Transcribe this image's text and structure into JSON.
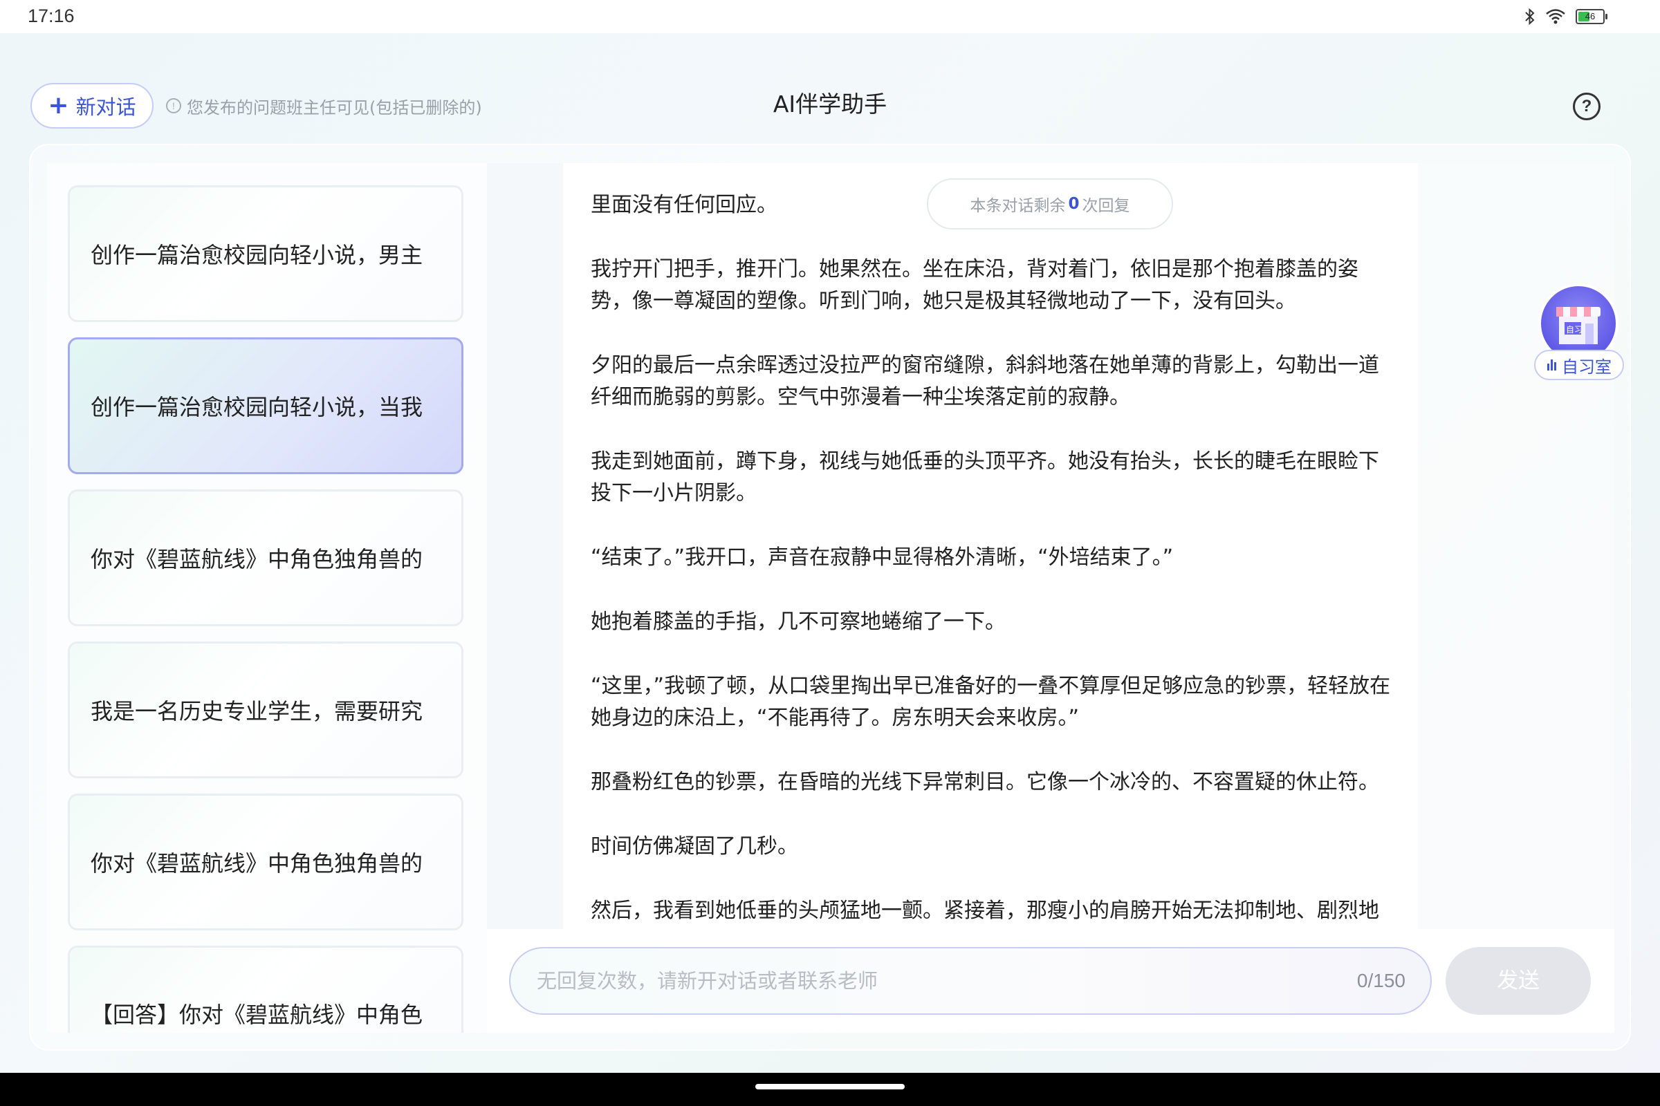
{
  "status_bar": {
    "time": "17:16",
    "battery_level": "46",
    "icons": [
      "bluetooth-icon",
      "wifi-icon",
      "battery-icon"
    ]
  },
  "header": {
    "new_chat_label": "新对话",
    "notice": "您发布的问题班主任可见(包括已删除的)",
    "title": "AI伴学助手",
    "help_symbol": "?"
  },
  "sidebar": {
    "items": [
      {
        "label": "创作一篇治愈校园向轻小说，男主",
        "active": false
      },
      {
        "label": "创作一篇治愈校园向轻小说，当我",
        "active": true
      },
      {
        "label": "你对《碧蓝航线》中角色独角兽的",
        "active": false
      },
      {
        "label": "我是一名历史专业学生，需要研究",
        "active": false
      },
      {
        "label": "你对《碧蓝航线》中角色独角兽的",
        "active": false
      },
      {
        "label": "【回答】你对《碧蓝航线》中角色",
        "active": false
      }
    ]
  },
  "chat": {
    "remaining_prefix": "本条对话剩余",
    "remaining_count": "0",
    "remaining_suffix": "次回复",
    "paragraphs": [
      "里面没有任何回应。",
      "我拧开门把手，推开门。她果然在。坐在床沿，背对着门，依旧是那个抱着膝盖的姿势，像一尊凝固的塑像。听到门响，她只是极其轻微地动了一下，没有回头。",
      "夕阳的最后一点余晖透过没拉严的窗帘缝隙，斜斜地落在她单薄的背影上，勾勒出一道纤细而脆弱的剪影。空气中弥漫着一种尘埃落定前的寂静。",
      "我走到她面前，蹲下身，视线与她低垂的头顶平齐。她没有抬头，长长的睫毛在眼睑下投下一小片阴影。",
      "“结束了。”我开口，声音在寂静中显得格外清晰，“外培结束了。”",
      "她抱着膝盖的手指，几不可察地蜷缩了一下。",
      "“这里，”我顿了顿，从口袋里掏出早已准备好的一叠不算厚但足够应急的钞票，轻轻放在她身边的床沿上，“不能再待了。房东明天会来收房。”",
      "那叠粉红色的钞票，在昏暗的光线下异常刺目。它像一个冰冷的、不容置疑的休止符。",
      "时间仿佛凝固了几秒。",
      "然后，我看到她低垂的头颅猛地一颤。紧接着，那瘦小的肩膀开始无法抑制地、剧烈地"
    ]
  },
  "input": {
    "placeholder": "无回复次数，请新开对话或者联系老师",
    "count": "0/150",
    "send_label": "发送"
  },
  "study_room": {
    "label": "自习室",
    "sign_text": "自习"
  },
  "colors": {
    "accent": "#3b55d6",
    "active_border": "#a3aaf0",
    "send_disabled": "#e3e5ea"
  }
}
